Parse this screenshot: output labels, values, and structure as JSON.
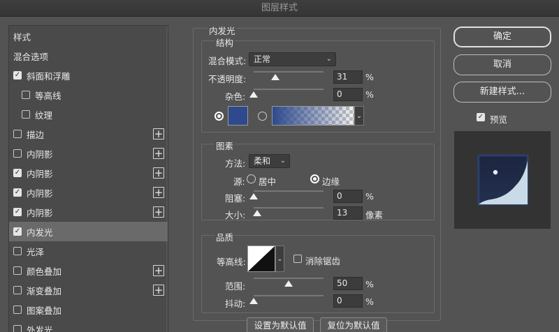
{
  "window": {
    "title": "图层样式"
  },
  "left_list": [
    {
      "label": "样式",
      "checkbox": null,
      "plus": false,
      "selected": false,
      "indent": 0
    },
    {
      "label": "混合选项",
      "checkbox": null,
      "plus": false,
      "selected": false,
      "indent": 0
    },
    {
      "label": "斜面和浮雕",
      "checkbox": true,
      "plus": false,
      "selected": false,
      "indent": 0
    },
    {
      "label": "等高线",
      "checkbox": false,
      "plus": false,
      "selected": false,
      "indent": 1
    },
    {
      "label": "纹理",
      "checkbox": false,
      "plus": false,
      "selected": false,
      "indent": 1
    },
    {
      "label": "描边",
      "checkbox": false,
      "plus": true,
      "selected": false,
      "indent": 0
    },
    {
      "label": "内阴影",
      "checkbox": false,
      "plus": true,
      "selected": false,
      "indent": 0
    },
    {
      "label": "内阴影",
      "checkbox": true,
      "plus": true,
      "selected": false,
      "indent": 0
    },
    {
      "label": "内阴影",
      "checkbox": true,
      "plus": true,
      "selected": false,
      "indent": 0
    },
    {
      "label": "内阴影",
      "checkbox": true,
      "plus": true,
      "selected": false,
      "indent": 0
    },
    {
      "label": "内发光",
      "checkbox": true,
      "plus": false,
      "selected": true,
      "indent": 0
    },
    {
      "label": "光泽",
      "checkbox": false,
      "plus": false,
      "selected": false,
      "indent": 0
    },
    {
      "label": "颜色叠加",
      "checkbox": false,
      "plus": true,
      "selected": false,
      "indent": 0
    },
    {
      "label": "渐变叠加",
      "checkbox": false,
      "plus": true,
      "selected": false,
      "indent": 0
    },
    {
      "label": "图案叠加",
      "checkbox": false,
      "plus": false,
      "selected": false,
      "indent": 0
    },
    {
      "label": "外发光",
      "checkbox": false,
      "plus": false,
      "selected": false,
      "indent": 0
    }
  ],
  "inner_glow": {
    "title": "内发光",
    "structure": {
      "title": "结构",
      "blend_mode_label": "混合模式:",
      "blend_mode_value": "正常",
      "opacity_label": "不透明度:",
      "opacity_value": "31",
      "opacity_unit": "%",
      "opacity_fraction": 0.31,
      "noise_label": "杂色:",
      "noise_value": "0",
      "noise_unit": "%",
      "noise_fraction": 0.0,
      "color_mode": "solid",
      "glow_color": "#2e4a8c"
    },
    "elements": {
      "title": "图素",
      "method_label": "方法:",
      "method_value": "柔和",
      "source_label": "源:",
      "source_center_label": "居中",
      "source_edge_label": "边缘",
      "source_selected": "edge",
      "choke_label": "阻塞:",
      "choke_value": "0",
      "choke_unit": "%",
      "choke_fraction": 0.0,
      "size_label": "大小:",
      "size_value": "13",
      "size_unit": "像素",
      "size_fraction": 0.054
    },
    "quality": {
      "title": "品质",
      "contour_label": "等高线:",
      "anti_alias_label": "消除锯齿",
      "anti_alias_checked": false,
      "range_label": "范围:",
      "range_value": "50",
      "range_unit": "%",
      "range_fraction": 0.5,
      "jitter_label": "抖动:",
      "jitter_value": "0",
      "jitter_unit": "%",
      "jitter_fraction": 0.0
    },
    "make_default_label": "设置为默认值",
    "reset_default_label": "复位为默认值"
  },
  "right": {
    "ok_label": "确定",
    "cancel_label": "取消",
    "new_style_label": "新建样式...",
    "preview_label": "预览",
    "preview_checked": true
  },
  "colors": {
    "accent": "#2e4a8c",
    "background": "#535353",
    "selection": "#6a6a6a"
  }
}
